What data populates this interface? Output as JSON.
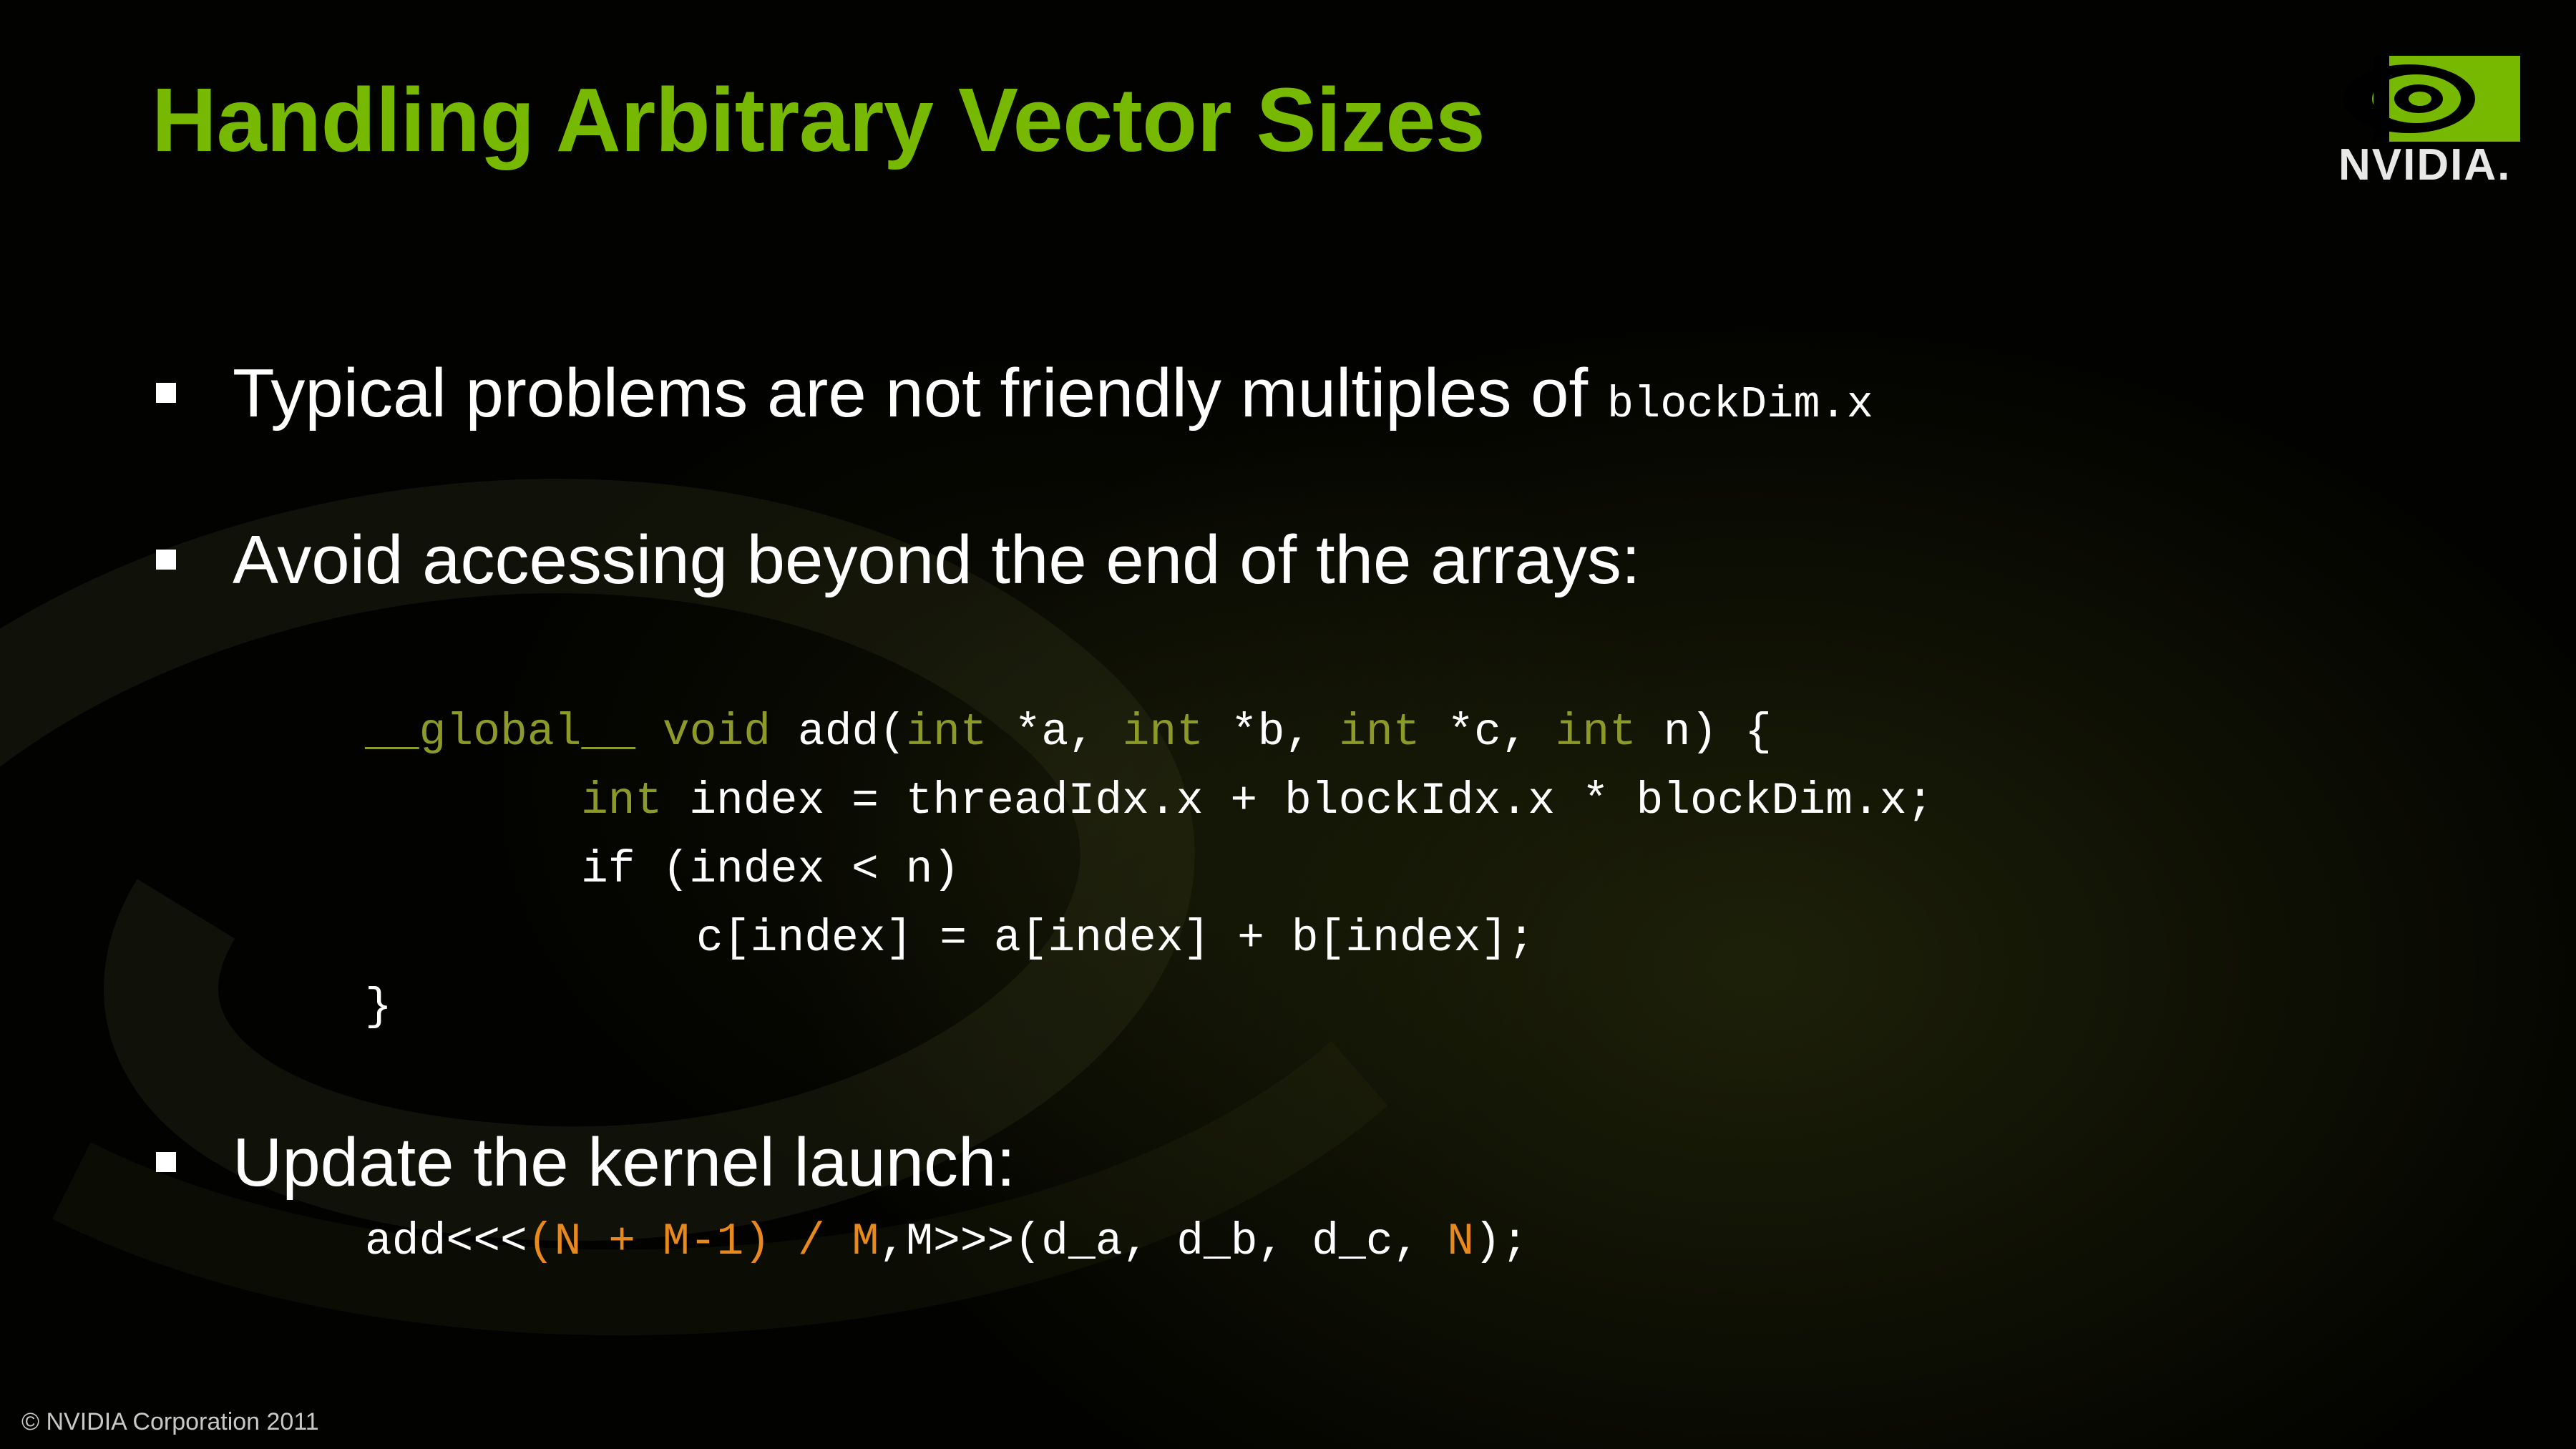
{
  "slide": {
    "title": "Handling Arbitrary Vector Sizes",
    "logo_text": "NVIDIA.",
    "footer": "© NVIDIA Corporation 2011",
    "colors": {
      "title": "#76b900",
      "keyword": "#8c9a2a",
      "highlight": "#e8891e",
      "background": "#000000"
    }
  },
  "bullets": [
    {
      "text": "Typical problems are not friendly multiples of ",
      "code": "blockDim.x"
    },
    {
      "text": "Avoid accessing beyond the end of the arrays:"
    },
    {
      "text": "Update the kernel launch:"
    }
  ],
  "kernel_code": {
    "line1": {
      "global": "__global__",
      "void": "void",
      "add_open": "add(",
      "int1": "int",
      "a": "*a,",
      "int2": "int",
      "b": "*b,",
      "int3": "int",
      "c": "*c,",
      "int4": "int",
      "n": "n)",
      "brace": "{"
    },
    "line2": {
      "int": "int",
      "rest": "index = threadIdx.x + blockIdx.x * blockDim.x;"
    },
    "line3": "if (index < n)",
    "line4": "c[index] = a[index] + b[index];",
    "line5": "}"
  },
  "launch_code": {
    "prefix": "add<<<",
    "grid": "(N + M-1) / M",
    "sep": ",M>>>(d_a, d_b, d_c,",
    "n": "N",
    "suffix": ");"
  }
}
